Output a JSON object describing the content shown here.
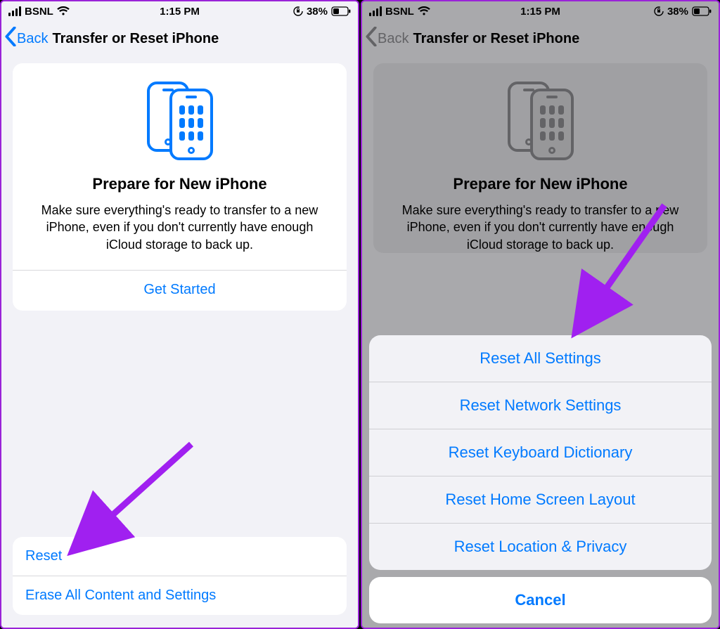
{
  "statusbar": {
    "carrier": "BSNL",
    "time": "1:15 PM",
    "battery": "38%"
  },
  "nav": {
    "back": "Back",
    "title": "Transfer or Reset iPhone"
  },
  "card": {
    "title": "Prepare for New iPhone",
    "desc": "Make sure everything's ready to transfer to a new iPhone, even if you don't currently have enough iCloud storage to back up.",
    "cta": "Get Started"
  },
  "bottom": {
    "reset": "Reset",
    "erase": "Erase All Content and Settings"
  },
  "sheet": {
    "items": [
      "Reset All Settings",
      "Reset Network Settings",
      "Reset Keyboard Dictionary",
      "Reset Home Screen Layout",
      "Reset Location & Privacy"
    ],
    "cancel": "Cancel"
  }
}
